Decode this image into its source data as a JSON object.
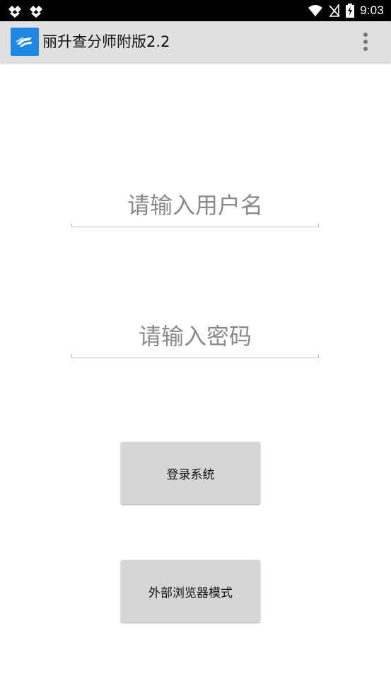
{
  "status_bar": {
    "time": "9:03",
    "icons": [
      "notification-app-icon",
      "notification-app-icon",
      "wifi-icon",
      "no-sim-icon",
      "battery-charging-icon"
    ]
  },
  "app_bar": {
    "title": "丽升查分师附版2.2",
    "logo_icon": "app-logo-icon",
    "menu_icon": "overflow-menu-icon"
  },
  "login_form": {
    "username_placeholder": "请输入用户名",
    "username_value": "",
    "password_placeholder": "请输入密码",
    "password_value": "",
    "login_button": "登录系统",
    "external_browser_button": "外部浏览器模式"
  },
  "colors": {
    "status_bar": "#000000",
    "app_bar": "#e0e0e0",
    "logo": "#1e88e5",
    "button": "#d6d6d6",
    "placeholder": "#8a8a8a"
  }
}
